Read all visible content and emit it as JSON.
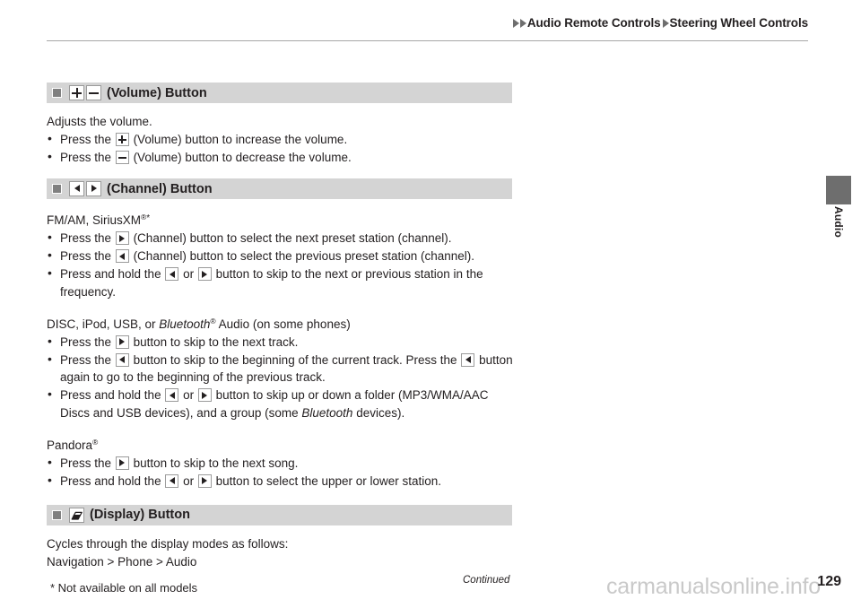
{
  "header": {
    "breadcrumb_primary": "Audio Remote Controls",
    "breadcrumb_secondary": "Steering Wheel Controls",
    "arrow_icon": "triangle-right-icon"
  },
  "side_tab": {
    "label": "Audio",
    "color": "#6e6e6e"
  },
  "sections": [
    {
      "id": "volume",
      "icons": [
        "plus-button-icon",
        "minus-button-icon"
      ],
      "title": "(Volume) Button",
      "intro": "Adjusts the volume.",
      "bullets": [
        {
          "pre": "Press the",
          "icon": "plus-button-icon",
          "post": "(Volume) button to increase the volume."
        },
        {
          "pre": "Press the",
          "icon": "minus-button-icon",
          "post": "(Volume) button to decrease the volume."
        }
      ]
    },
    {
      "id": "channel",
      "icons": [
        "arrow-left-button-icon",
        "arrow-right-button-icon"
      ],
      "title": "(Channel) Button",
      "groups": [
        {
          "heading": "FM/AM, SiriusXM",
          "heading_sup_registered": "®",
          "heading_sup_star": "*",
          "bullets": [
            {
              "pre": "Press the",
              "icon": "arrow-right-button-icon",
              "post": "(Channel) button to select the next preset station (channel)."
            },
            {
              "pre": "Press the",
              "icon": "arrow-left-button-icon",
              "post": "(Channel) button to select the previous preset station (channel)."
            },
            {
              "pre": "Press and hold the",
              "icon": "arrow-left-button-icon",
              "mid": "or",
              "icon2": "arrow-right-button-icon",
              "post": "button to skip to the next or previous station in the frequency."
            }
          ]
        },
        {
          "heading_plain_1": "DISC, iPod, USB, or ",
          "heading_italic": "Bluetooth",
          "heading_sup_registered": "®",
          "heading_plain_2": " Audio (on some phones)",
          "bullets": [
            {
              "pre": "Press the",
              "icon": "arrow-right-button-icon",
              "post": "button to skip to the next track."
            },
            {
              "pre": "Press the",
              "icon": "arrow-left-button-icon",
              "post": "button to skip to the beginning of the current track. Press the",
              "icon2": "arrow-left-button-icon",
              "post2": "button again to go to the beginning of the previous track."
            },
            {
              "pre": "Press and hold the",
              "icon": "arrow-left-button-icon",
              "mid": "or",
              "icon2": "arrow-right-button-icon",
              "post": "button to skip up or down a folder (MP3/WMA/AAC Discs and USB devices), and a group (some",
              "italic_word": "Bluetooth",
              "post2": "devices)."
            }
          ]
        },
        {
          "heading": "Pandora",
          "heading_sup_registered": "®",
          "bullets": [
            {
              "pre": "Press the",
              "icon": "arrow-right-button-icon",
              "post": "button to skip to the next song."
            },
            {
              "pre": "Press and hold the",
              "icon": "arrow-left-button-icon",
              "mid": "or",
              "icon2": "arrow-right-button-icon",
              "post": "button to select the upper or lower station."
            }
          ]
        }
      ]
    },
    {
      "id": "display",
      "icons": [
        "display-button-icon"
      ],
      "title": "(Display) Button",
      "intro": "Cycles through the display modes as follows:",
      "modes": "Navigation > Phone > Audio"
    }
  ],
  "footer": {
    "footnote": "* Not available on all models",
    "continued": "Continued",
    "page_number": "129",
    "watermark": "carmanualsonline.info"
  }
}
